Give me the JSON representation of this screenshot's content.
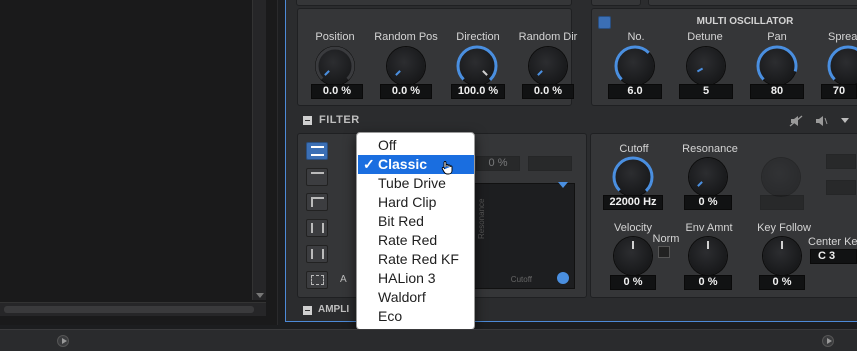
{
  "osc_section": {
    "knobs": [
      {
        "label": "Position",
        "value": "0.0 %"
      },
      {
        "label": "Random Pos",
        "value": "0.0 %"
      },
      {
        "label": "Direction",
        "value": "100.0 %"
      },
      {
        "label": "Random Dir",
        "value": "0.0 %"
      }
    ]
  },
  "multi_osc": {
    "title": "MULTI OSCILLATOR",
    "knobs": [
      {
        "label": "No.",
        "value": "6.0"
      },
      {
        "label": "Detune",
        "value": "5"
      },
      {
        "label": "Pan",
        "value": "80"
      },
      {
        "label": "Spread",
        "value": "70"
      }
    ]
  },
  "filter": {
    "title": "FILTER",
    "hidden_fields": [
      "0 %",
      "0 %"
    ],
    "xy_pad": {
      "x_label": "Cutoff",
      "y_label": "Resonance"
    },
    "type_letter": "A",
    "knobs": [
      {
        "label": "Cutoff",
        "value": "22000 Hz"
      },
      {
        "label": "Resonance",
        "value": "0 %"
      },
      {
        "label": "Velocity",
        "value": "0 %"
      },
      {
        "label": "Env Amnt",
        "value": "0 %"
      },
      {
        "label": "Key Follow",
        "value": "0 %"
      }
    ],
    "norm_label": "Norm",
    "center_key_label": "Center Key",
    "center_key_value": "C 3"
  },
  "amplifier": {
    "title": "AMPLI"
  },
  "dropdown": {
    "items": [
      "Off",
      "Classic",
      "Tube Drive",
      "Hard Clip",
      "Bit Red",
      "Rate Red",
      "Rate Red KF",
      "HALion 3",
      "Waldorf",
      "Eco"
    ],
    "selected": "Classic",
    "check": "✓"
  },
  "colors": {
    "accent": "#4d8ad8",
    "selection": "#1a6ee0",
    "knob_arc": "#4a8fe0"
  }
}
